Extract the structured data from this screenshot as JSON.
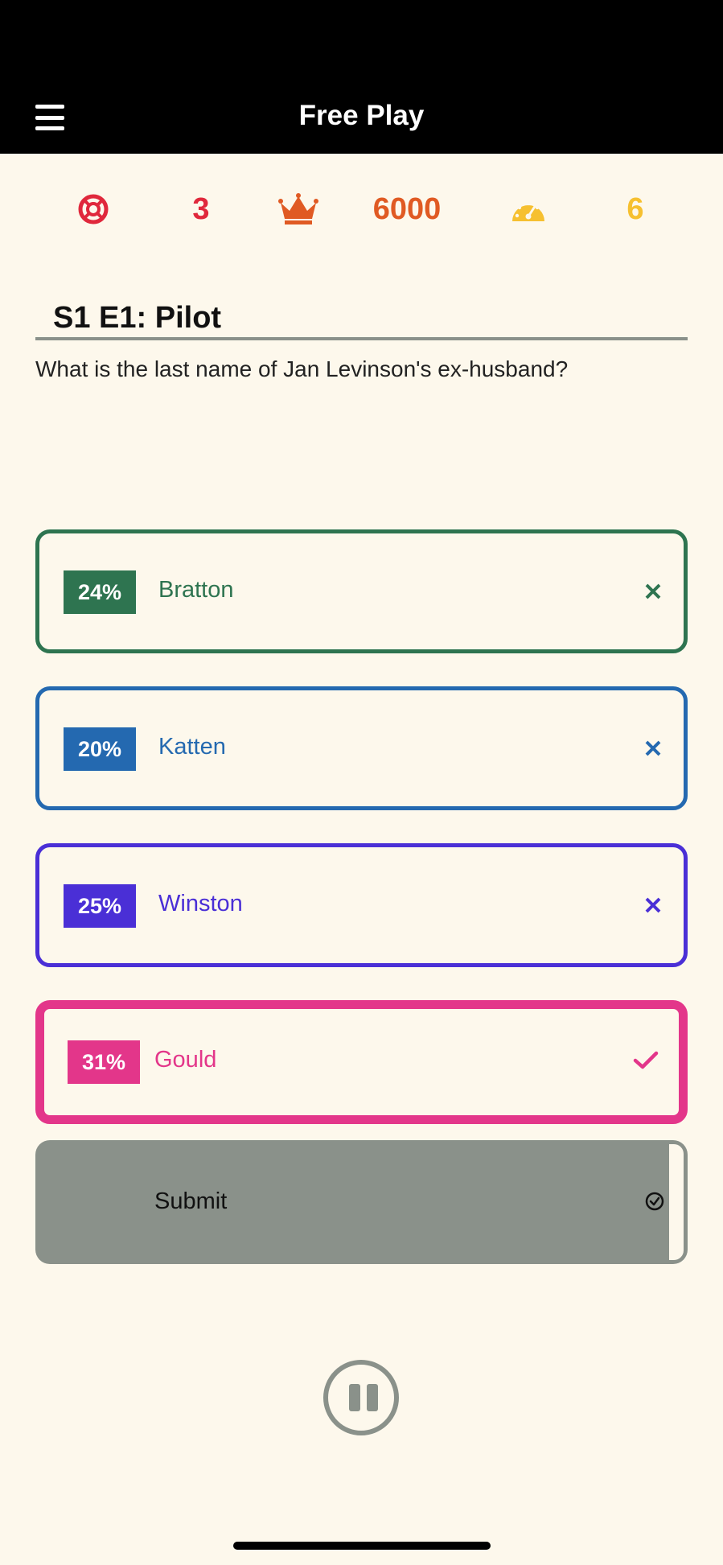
{
  "header": {
    "title": "Free Play",
    "menu_icon": "hamburger-menu-icon"
  },
  "stats": {
    "lifelines": {
      "icon": "lifebuoy-icon",
      "value": "3",
      "color": "#e0283c"
    },
    "score": {
      "icon": "crown-icon",
      "value": "6000",
      "color": "#e05a23"
    },
    "speed": {
      "icon": "speedometer-icon",
      "value": "6",
      "color": "#f6c030"
    }
  },
  "episode": {
    "title": "S1 E1: Pilot"
  },
  "question": {
    "text": "What is the last name of Jan Levinson's ex-husband?"
  },
  "options": [
    {
      "percent": "24%",
      "answer": "Bratton",
      "status": "wrong",
      "icon": "x-icon",
      "color": "#2e7450"
    },
    {
      "percent": "20%",
      "answer": "Katten",
      "status": "wrong",
      "icon": "x-icon",
      "color": "#2469b0"
    },
    {
      "percent": "25%",
      "answer": "Winston",
      "status": "wrong",
      "icon": "x-icon",
      "color": "#4a2fd6"
    },
    {
      "percent": "31%",
      "answer": "Gould",
      "status": "correct",
      "icon": "checkmark-icon",
      "color": "#e3368a"
    }
  ],
  "submit": {
    "label": "Submit",
    "icon": "check-circle-icon"
  },
  "controls": {
    "pause_icon": "pause-icon"
  }
}
